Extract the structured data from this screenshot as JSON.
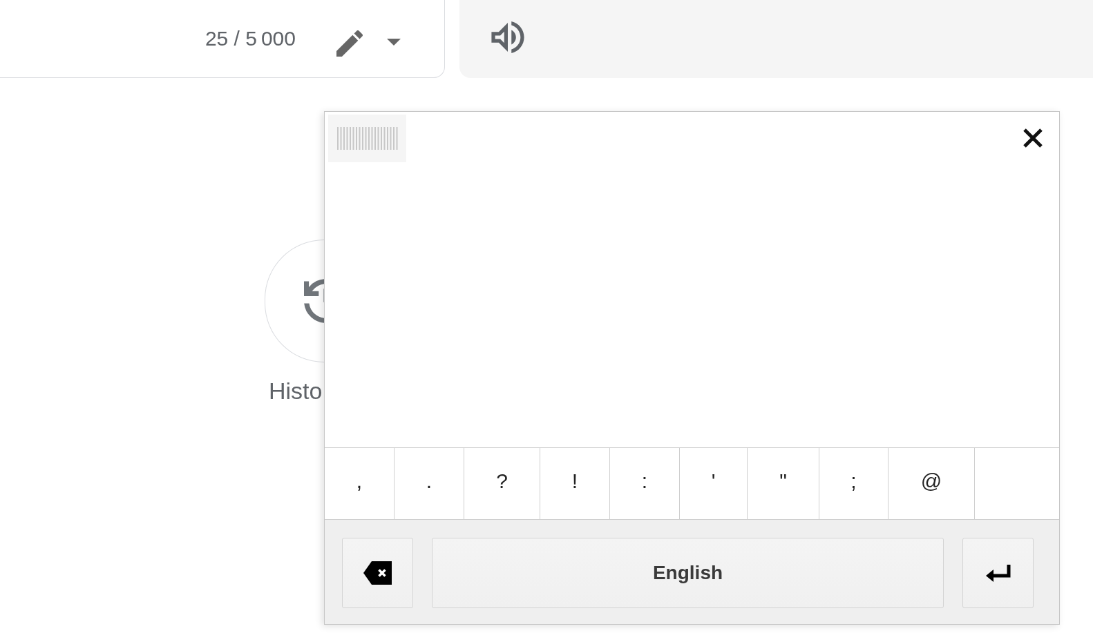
{
  "source_panel": {
    "char_count": "25 / 5 000"
  },
  "history": {
    "label": "Histo"
  },
  "virtual_keyboard": {
    "keys": [
      {
        "kind": "char",
        "label": ","
      },
      {
        "kind": "char",
        "label": "."
      },
      {
        "kind": "char",
        "label": "?"
      },
      {
        "kind": "char",
        "label": "!"
      },
      {
        "kind": "char",
        "label": ":"
      },
      {
        "kind": "char",
        "label": "'"
      },
      {
        "kind": "char",
        "label": "\""
      },
      {
        "kind": "char",
        "label": ";"
      },
      {
        "kind": "char",
        "label": "@"
      },
      {
        "kind": "blank"
      }
    ],
    "language_key": "English"
  }
}
